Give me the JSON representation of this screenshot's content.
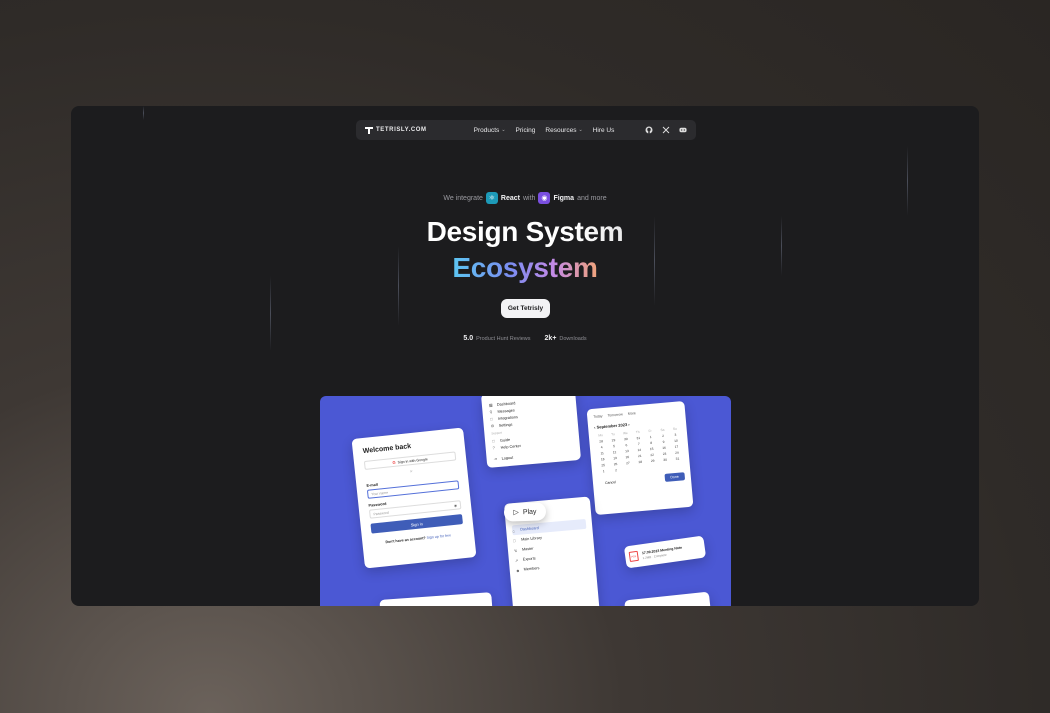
{
  "nav": {
    "logo": "TETRISLY.COM",
    "links": [
      {
        "label": "Products",
        "dropdown": true
      },
      {
        "label": "Pricing",
        "dropdown": false
      },
      {
        "label": "Resources",
        "dropdown": true
      },
      {
        "label": "Hire Us",
        "dropdown": false
      }
    ],
    "icons": [
      "github-icon",
      "x-icon",
      "discord-icon"
    ]
  },
  "hero": {
    "integrate_prefix": "We integrate",
    "react_label": "React",
    "with_label": "with",
    "figma_label": "Figma",
    "suffix": "and more",
    "title_line1": "Design System",
    "title_line2": "Ecosystem",
    "cta_label": "Get Tetrisly",
    "stats": [
      {
        "value": "5.0",
        "label": "Product Hunt Reviews"
      },
      {
        "value": "2k+",
        "label": "Downloads"
      }
    ]
  },
  "showcase": {
    "login": {
      "title": "Welcome back",
      "google": "Sign in with Google",
      "or": "or",
      "email_label": "E-mail",
      "email_placeholder": "Your name",
      "password_label": "Password",
      "password_placeholder": "Password",
      "signin": "Sign in",
      "footer_text": "Don't have an account?",
      "footer_link": "Sign up for free"
    },
    "menu_top": {
      "items": [
        "Dashboard",
        "Messages",
        "Integrations",
        "Settings"
      ],
      "section": "Support",
      "support_items": [
        "Guide",
        "Help Center"
      ],
      "logout": "Logout"
    },
    "calendar": {
      "tabs": [
        "Today",
        "Tomorrow",
        "More"
      ],
      "month": "September 2023",
      "weekdays": [
        "Mo",
        "Tu",
        "We",
        "Th",
        "Fr",
        "Sa",
        "Su"
      ],
      "days": [
        "28",
        "29",
        "30",
        "31",
        "1",
        "2",
        "3",
        "4",
        "5",
        "6",
        "7",
        "8",
        "9",
        "10",
        "11",
        "12",
        "13",
        "14",
        "15",
        "16",
        "17",
        "18",
        "19",
        "20",
        "21",
        "22",
        "23",
        "24",
        "25",
        "26",
        "27",
        "28",
        "29",
        "30",
        "31",
        "1",
        "2"
      ],
      "cancel": "Cancel",
      "done": "Done"
    },
    "play_label": "Play",
    "menu_bottom": {
      "items": [
        "Dashboard",
        "Main Library",
        "Master",
        "Exports",
        "Members"
      ]
    },
    "notification": {
      "file_type": "PDF",
      "title": "17.09.2023 Meeting Note",
      "meta": "1.2MB · Complete"
    },
    "colors": {
      "background": "#4b58d4",
      "primary": "#3f5db8"
    }
  }
}
